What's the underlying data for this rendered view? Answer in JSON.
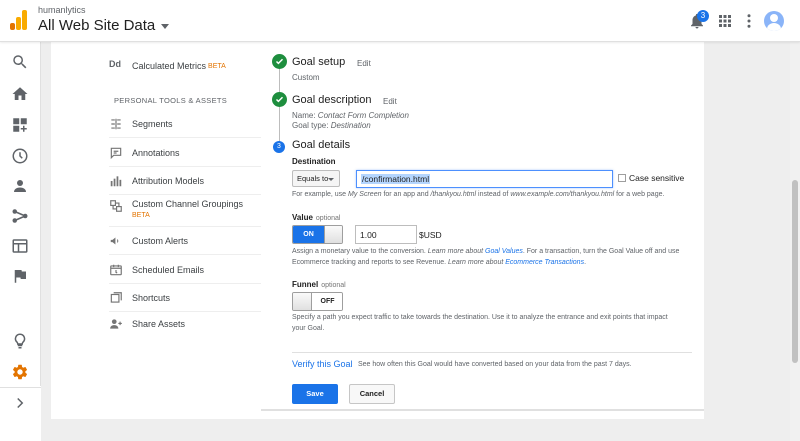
{
  "header": {
    "account": "humanlytics",
    "property": "All Web Site Data",
    "notification_count": "3"
  },
  "rail": {
    "icons": [
      "search-icon",
      "home-icon",
      "customization-icon",
      "realtime-icon",
      "audience-icon",
      "acquisition-icon",
      "behavior-icon",
      "conversions-icon",
      "discover-icon",
      "admin-icon",
      "expand-icon"
    ],
    "active": "admin-icon",
    "accent": "#e37400"
  },
  "nav": {
    "calculated_metrics": "Calculated Metrics",
    "calculated_metrics_badge": "BETA",
    "section_title": "PERSONAL TOOLS & ASSETS",
    "items": [
      {
        "label": "Segments"
      },
      {
        "label": "Annotations"
      },
      {
        "label": "Attribution Models"
      },
      {
        "label": "Custom Channel Groupings",
        "badge": "BETA"
      },
      {
        "label": "Custom Alerts"
      },
      {
        "label": "Scheduled Emails"
      },
      {
        "label": "Shortcuts"
      },
      {
        "label": "Share Assets"
      }
    ]
  },
  "goal": {
    "setup": {
      "title": "Goal setup",
      "edit": "Edit",
      "value": "Custom"
    },
    "description": {
      "title": "Goal description",
      "edit": "Edit",
      "name_label": "Name:",
      "name_value": "Contact Form Completion",
      "type_label": "Goal type:",
      "type_value": "Destination"
    },
    "details": {
      "step_number": "3",
      "title": "Goal details",
      "destination_label": "Destination",
      "match_type": "Equals to",
      "destination_value": "/confirmation.html",
      "case_sensitive_label": "Case sensitive",
      "destination_help_1": "For example, use ",
      "destination_help_2": "My Screen",
      "destination_help_3": " for an app and ",
      "destination_help_4": "/thankyou.html",
      "destination_help_5": " instead of ",
      "destination_help_6": "www.example.com/thankyou.html",
      "destination_help_7": " for a web page.",
      "value_label": "Value",
      "optional": "optional",
      "value_toggle": "ON",
      "value_amount": "1.00",
      "currency": "$USD",
      "value_help_1": "Assign a monetary value to the conversion. ",
      "value_help_2": "Learn more about ",
      "value_help_link1": "Goal Values",
      "value_help_3": ". For a transaction, turn the Goal Value off and use Ecommerce tracking and reports to see Revenue. ",
      "value_help_4": "Learn more about ",
      "value_help_link2": "Ecommerce Transactions",
      "value_help_5": ".",
      "funnel_label": "Funnel",
      "funnel_toggle": "OFF",
      "funnel_help": "Specify a path you expect traffic to take towards the destination. Use it to analyze the entrance and exit points that impact your Goal.",
      "verify_link": "Verify this Goal",
      "verify_desc": "See how often this Goal would have converted based on your data from the past 7 days.",
      "save": "Save",
      "cancel": "Cancel"
    }
  },
  "colors": {
    "primary": "#1a73e8",
    "success": "#1e8e3e",
    "beta": "#e37400"
  }
}
